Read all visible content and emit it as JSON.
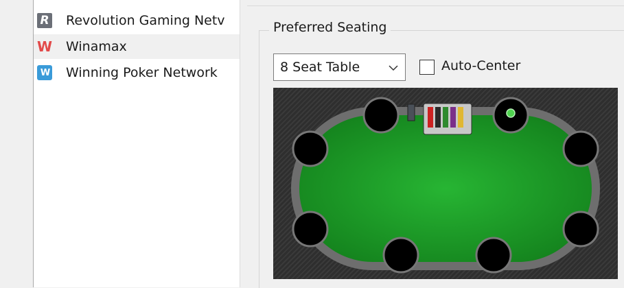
{
  "networks": {
    "items": [
      {
        "label": "Revolution Gaming Netv",
        "icon": "revolution-icon"
      },
      {
        "label": "Winamax",
        "icon": "winamax-icon"
      },
      {
        "label": "Winning Poker Network",
        "icon": "winning-poker-network-icon"
      }
    ],
    "selected_index": 1
  },
  "seating": {
    "group_title": "Preferred Seating",
    "table_select_value": "8 Seat Table",
    "auto_center_label": "Auto-Center",
    "auto_center_checked": false,
    "seat_count": 8
  },
  "colors": {
    "felt": "#1fa82b",
    "rail": "#6e6e6e",
    "seat": "#000000",
    "dealer_button": "#4fd24f"
  }
}
